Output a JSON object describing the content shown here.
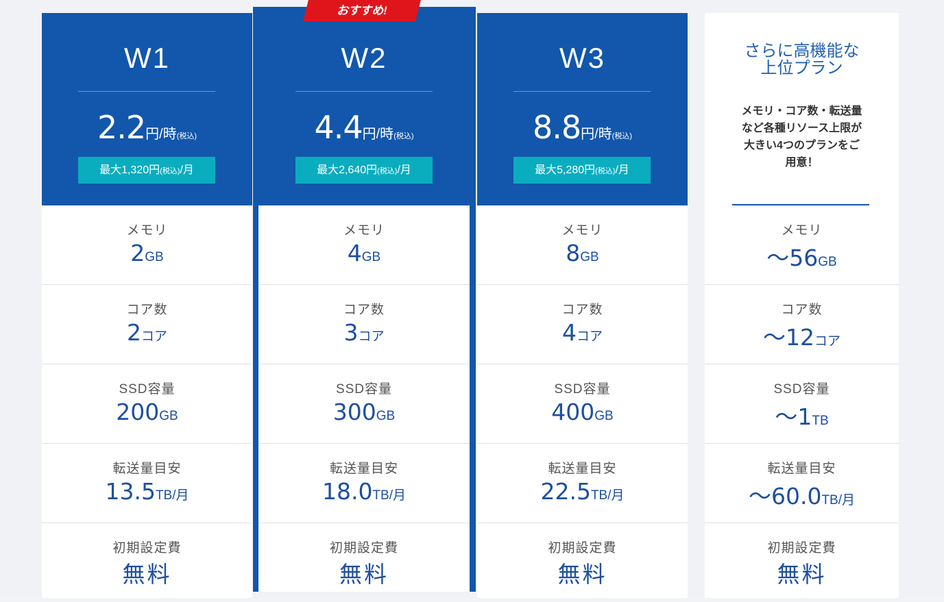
{
  "badge": "おすすめ!",
  "plans": [
    {
      "name": "W1",
      "price": "2.2",
      "price_unit": "円/時",
      "price_tax": "(税込)",
      "monthly_prefix": "最大1,320円",
      "monthly_tax": "(税込)",
      "monthly_suffix": "/月",
      "rows": [
        {
          "label": "メモリ",
          "value": "2",
          "unit": "GB"
        },
        {
          "label": "コア数",
          "value": "2",
          "unit": "コア"
        },
        {
          "label": "SSD容量",
          "value": "200",
          "unit": "GB"
        },
        {
          "label": "転送量目安",
          "value": "13.5",
          "unit": "TB/月"
        },
        {
          "label": "初期設定費",
          "value": "無料",
          "unit": ""
        }
      ]
    },
    {
      "name": "W2",
      "price": "4.4",
      "price_unit": "円/時",
      "price_tax": "(税込)",
      "monthly_prefix": "最大2,640円",
      "monthly_tax": "(税込)",
      "monthly_suffix": "/月",
      "rows": [
        {
          "label": "メモリ",
          "value": "4",
          "unit": "GB"
        },
        {
          "label": "コア数",
          "value": "3",
          "unit": "コア"
        },
        {
          "label": "SSD容量",
          "value": "300",
          "unit": "GB"
        },
        {
          "label": "転送量目安",
          "value": "18.0",
          "unit": "TB/月"
        },
        {
          "label": "初期設定費",
          "value": "無料",
          "unit": ""
        }
      ]
    },
    {
      "name": "W3",
      "price": "8.8",
      "price_unit": "円/時",
      "price_tax": "(税込)",
      "monthly_prefix": "最大5,280円",
      "monthly_tax": "(税込)",
      "monthly_suffix": "/月",
      "rows": [
        {
          "label": "メモリ",
          "value": "8",
          "unit": "GB"
        },
        {
          "label": "コア数",
          "value": "4",
          "unit": "コア"
        },
        {
          "label": "SSD容量",
          "value": "400",
          "unit": "GB"
        },
        {
          "label": "転送量目安",
          "value": "22.5",
          "unit": "TB/月"
        },
        {
          "label": "初期設定費",
          "value": "無料",
          "unit": ""
        }
      ]
    }
  ],
  "upper": {
    "title_line1": "さらに高機能な",
    "title_line2": "上位プラン",
    "desc": "メモリ・コア数・転送量など各種リソース上限が大きい4つのプランをご用意！",
    "rows": [
      {
        "label": "メモリ",
        "value": "～56",
        "unit": "GB"
      },
      {
        "label": "コア数",
        "value": "～12",
        "unit": "コア"
      },
      {
        "label": "SSD容量",
        "value": "～1",
        "unit": "TB"
      },
      {
        "label": "転送量目安",
        "value": "～60.0",
        "unit": "TB/月"
      },
      {
        "label": "初期設定費",
        "value": "無料",
        "unit": ""
      }
    ]
  },
  "colors": {
    "brand_blue": "#1257ac",
    "teal": "#0aadbe",
    "badge_red": "#e0151c",
    "value_blue": "#1d4fa0"
  }
}
